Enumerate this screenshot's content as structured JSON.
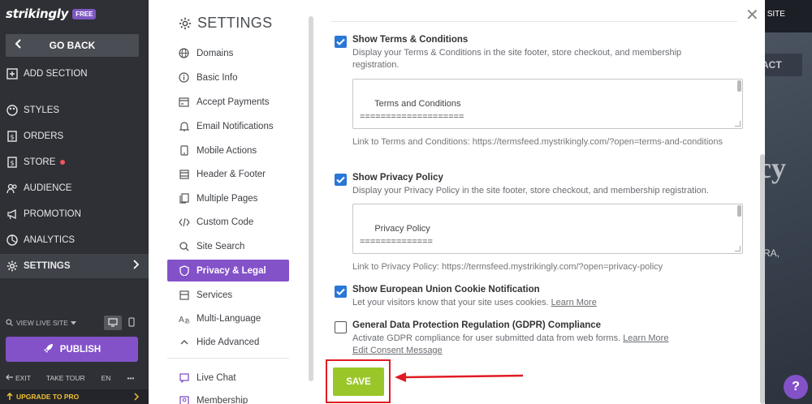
{
  "editor": {
    "brand": "strikingly",
    "badge": "FREE",
    "go_back": "GO BACK",
    "nav": [
      {
        "label": "ADD SECTION",
        "icon": "plus-square-icon"
      },
      {
        "label": "STYLES",
        "icon": "palette-icon"
      },
      {
        "label": "ORDERS",
        "icon": "dollar-icon"
      },
      {
        "label": "STORE",
        "icon": "store-icon"
      },
      {
        "label": "AUDIENCE",
        "icon": "audience-icon"
      },
      {
        "label": "PROMOTION",
        "icon": "megaphone-icon"
      },
      {
        "label": "ANALYTICS",
        "icon": "analytics-icon"
      },
      {
        "label": "SETTINGS",
        "icon": "gear-icon"
      }
    ],
    "view_live_site": "VIEW LIVE SITE",
    "publish": "PUBLISH",
    "footer": {
      "exit": "EXIT",
      "take_tour": "TAKE TOUR",
      "lang": "EN",
      "more": "•••"
    },
    "upgrade": "UPGRADE TO PRO"
  },
  "preview": {
    "site_button": "T SITE",
    "contact": "ACT",
    "headline_fragment": "cy",
    "subtext_fragment": "RA,",
    "help": "?"
  },
  "settings": {
    "title": "SETTINGS",
    "menu": [
      {
        "label": "Domains",
        "icon": "globe-icon"
      },
      {
        "label": "Basic Info",
        "icon": "info-icon"
      },
      {
        "label": "Accept Payments",
        "icon": "payment-icon"
      },
      {
        "label": "Email Notifications",
        "icon": "bell-icon"
      },
      {
        "label": "Mobile Actions",
        "icon": "mobile-icon"
      },
      {
        "label": "Header & Footer",
        "icon": "header-footer-icon"
      },
      {
        "label": "Multiple Pages",
        "icon": "pages-icon"
      },
      {
        "label": "Custom Code",
        "icon": "code-icon"
      },
      {
        "label": "Site Search",
        "icon": "search-icon"
      },
      {
        "label": "Privacy & Legal",
        "icon": "shield-icon"
      },
      {
        "label": "Services",
        "icon": "services-icon"
      },
      {
        "label": "Multi-Language",
        "icon": "translate-icon"
      },
      {
        "label": "Hide Advanced",
        "icon": "chevron-up-icon"
      },
      {
        "label": "Live Chat",
        "icon": "chat-icon"
      },
      {
        "label": "Membership",
        "icon": "membership-icon"
      }
    ],
    "active_item": "Privacy & Legal",
    "options": {
      "terms": {
        "checked": true,
        "title": "Show Terms & Conditions",
        "desc": "Display your Terms & Conditions in the site footer, store checkout, and membership registration.",
        "textarea": "Terms and Conditions\n====================",
        "link": "Link to Terms and Conditions: https://termsfeed.mystrikingly.com/?open=terms-and-conditions"
      },
      "privacy": {
        "checked": true,
        "title": "Show Privacy Policy",
        "desc": "Display your Privacy Policy in the site footer, store checkout, and membership registration.",
        "textarea": "Privacy Policy\n==============",
        "link": "Link to Privacy Policy: https://termsfeed.mystrikingly.com/?open=privacy-policy"
      },
      "cookie": {
        "checked": true,
        "title": "Show European Union Cookie Notification",
        "desc": "Let your visitors know that your site uses cookies.",
        "learn_more": "Learn More"
      },
      "gdpr": {
        "checked": false,
        "title": "General Data Protection Regulation (GDPR) Compliance",
        "desc": "Activate GDPR compliance for user submitted data from web forms.",
        "learn_more": "Learn More",
        "edit_consent": "Edit Consent Message"
      }
    },
    "save": "SAVE",
    "close": "✕"
  },
  "colors": {
    "sidebar_bg": "#2e3035",
    "accent_purple": "#8352c9",
    "checkbox_blue": "#2a77d6",
    "save_green": "#9bc62a",
    "highlight_red": "#e01b24"
  }
}
